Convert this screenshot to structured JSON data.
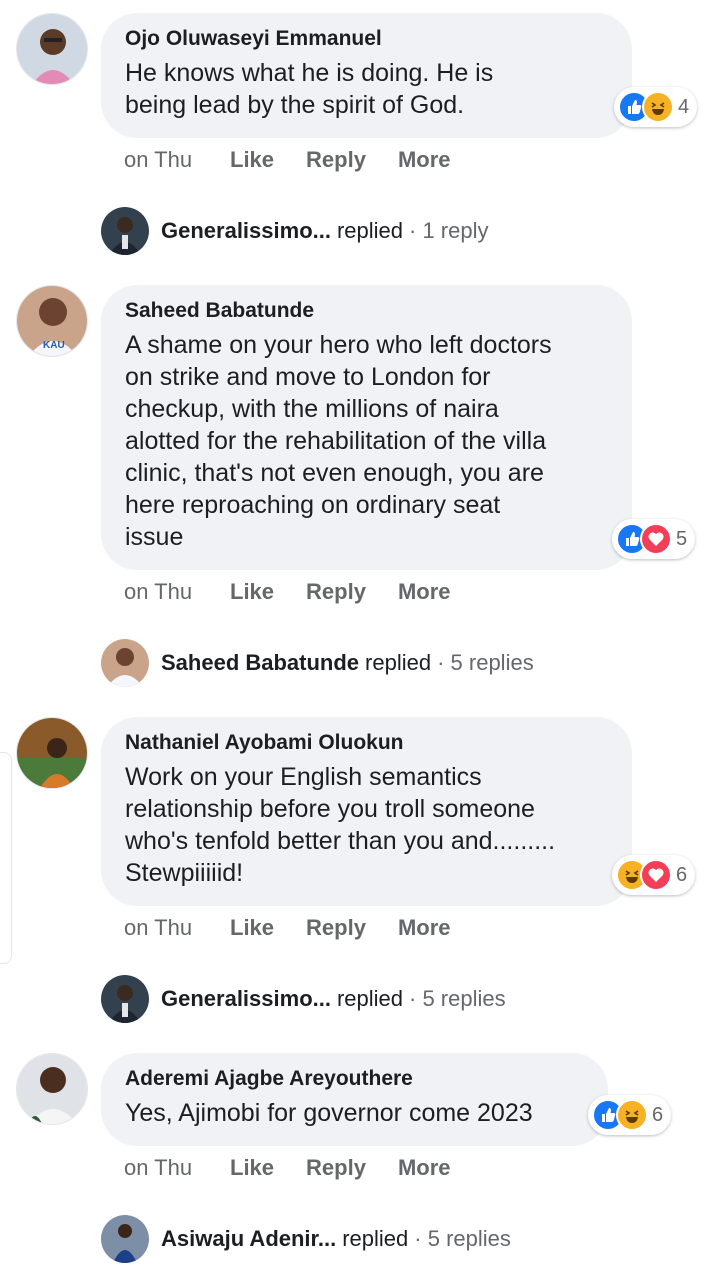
{
  "comments": [
    {
      "author": "Ojo Oluwaseyi Emmanuel",
      "text": "He knows what he is doing. He is\nbeing lead by the spirit of God.",
      "reaction_count": "4",
      "reactions": [
        "like-icon",
        "haha-icon"
      ],
      "time": "on Thu",
      "like": "Like",
      "reply": "Reply",
      "more": "More",
      "reply_summary": {
        "name": "Generalissimo...",
        "verb": "replied",
        "count": "· 1 reply"
      }
    },
    {
      "author": "Saheed Babatunde",
      "text": "A shame on your hero who left doctors\non strike and move to London for\ncheckup, with the millions of naira\nalotted for the rehabilitation of the villa\nclinic, that's not even enough, you are\nhere reproaching on ordinary seat\nissue",
      "reaction_count": "5",
      "reactions": [
        "like-icon",
        "love-icon"
      ],
      "time": "on Thu",
      "like": "Like",
      "reply": "Reply",
      "more": "More",
      "reply_summary": {
        "name": "Saheed Babatunde",
        "verb": "replied",
        "count": "· 5 replies"
      }
    },
    {
      "author": "Nathaniel Ayobami Oluokun",
      "text": "Work on your English semantics\nrelationship before you troll someone\nwho's tenfold better than you and.........\nStewpiiiiid!",
      "reaction_count": "6",
      "reactions": [
        "haha-icon",
        "love-icon"
      ],
      "time": "on Thu",
      "like": "Like",
      "reply": "Reply",
      "more": "More",
      "reply_summary": {
        "name": "Generalissimo...",
        "verb": "replied",
        "count": "· 5 replies"
      }
    },
    {
      "author": "Aderemi Ajagbe Areyouthere",
      "text": "Yes, Ajimobi for governor come 2023",
      "reaction_count": "6",
      "reactions": [
        "like-icon",
        "haha-icon"
      ],
      "time": "on Thu",
      "like": "Like",
      "reply": "Reply",
      "more": "More",
      "reply_summary": {
        "name": "Asiwaju Adenir...",
        "verb": "replied",
        "count": "· 5 replies"
      }
    }
  ],
  "colors": {
    "bubble": "#f0f2f5",
    "like": "#1877f2",
    "love": "#f33e58",
    "haha": "#f7b125",
    "secondary_text": "#65676b"
  }
}
